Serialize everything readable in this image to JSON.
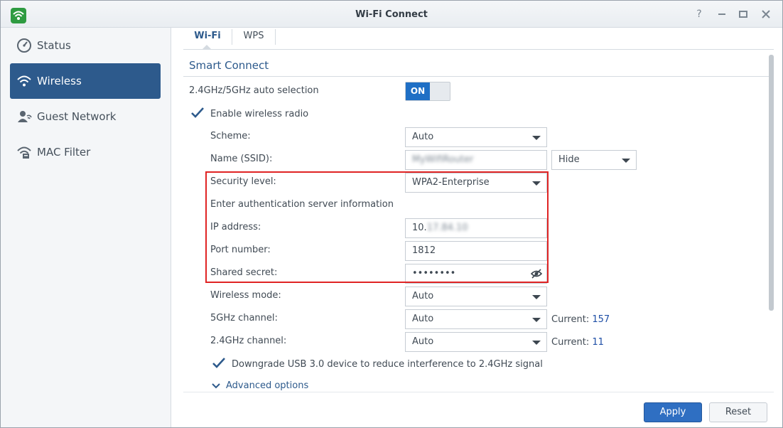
{
  "window": {
    "title": "Wi-Fi Connect",
    "controls": [
      "help-icon",
      "minimize-icon",
      "maximize-icon",
      "close-icon"
    ]
  },
  "sidebar": {
    "items": [
      {
        "label": "Status",
        "icon": "status-gauge-icon",
        "active": false
      },
      {
        "label": "Wireless",
        "icon": "wifi-icon",
        "active": true
      },
      {
        "label": "Guest Network",
        "icon": "guest-icon",
        "active": false
      },
      {
        "label": "MAC Filter",
        "icon": "mac-filter-icon",
        "active": false
      }
    ]
  },
  "tabs": [
    {
      "label": "Wi-Fi",
      "active": true
    },
    {
      "label": "WPS",
      "active": false
    }
  ],
  "smart_connect": {
    "title": "Smart Connect",
    "auto_selection_label": "2.4GHz/5GHz auto selection",
    "toggle_label": "ON"
  },
  "radio": {
    "enable_label": "Enable wireless radio",
    "enabled": true
  },
  "form": {
    "scheme_label": "Scheme:",
    "scheme_value": "Auto",
    "ssid_label": "Name (SSID):",
    "ssid_value": "MyWifiRouter",
    "ssid_visibility": "Hide",
    "security_label": "Security level:",
    "security_value": "WPA2-Enterprise",
    "auth_info_label": "Enter authentication server information",
    "ip_label": "IP address:",
    "ip_prefix": "10.",
    "ip_masked": "17.84.10",
    "port_label": "Port number:",
    "port_value": "1812",
    "secret_label": "Shared secret:",
    "secret_value": "••••••••",
    "wireless_mode_label": "Wireless mode:",
    "wireless_mode_value": "Auto",
    "ch5_label": "5GHz channel:",
    "ch5_value": "Auto",
    "ch5_current_label": "Current:",
    "ch5_current_value": "157",
    "ch24_label": "2.4GHz channel:",
    "ch24_value": "Auto",
    "ch24_current_label": "Current:",
    "ch24_current_value": "11"
  },
  "usb": {
    "label": "Downgrade USB 3.0 device to reduce interference to 2.4GHz signal",
    "checked": true
  },
  "advanced": {
    "label": "Advanced options"
  },
  "buttons": {
    "apply": "Apply",
    "reset": "Reset"
  },
  "colors": {
    "accent": "#2d5a8c",
    "primary_button": "#2f6fc2",
    "highlight": "#e02424",
    "toggle_on": "#1f6fc5",
    "app_icon": "#2e9b41"
  }
}
